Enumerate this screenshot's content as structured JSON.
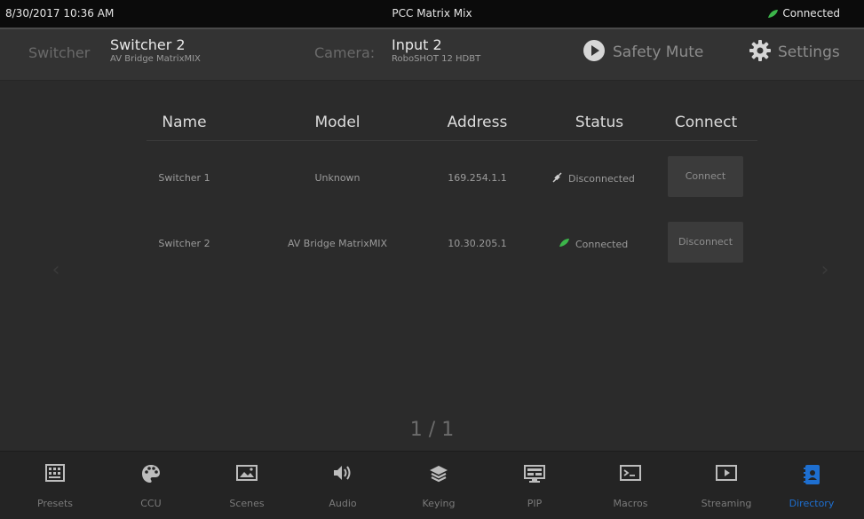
{
  "statusbar": {
    "datetime": "8/30/2017 10:36 AM",
    "title": "PCC Matrix Mix",
    "connection": "Connected"
  },
  "header": {
    "switcher_label": "Switcher",
    "switcher_name": "Switcher 2",
    "switcher_model": "AV Bridge MatrixMIX",
    "camera_label": "Camera:",
    "camera_name": "Input 2",
    "camera_model": "RoboSHOT 12 HDBT",
    "safety_mute": "Safety Mute",
    "settings": "Settings"
  },
  "table": {
    "headers": [
      "Name",
      "Model",
      "Address",
      "Status",
      "Connect"
    ],
    "rows": [
      {
        "name": "Switcher 1",
        "model": "Unknown",
        "address": "169.254.1.1",
        "status": "Disconnected",
        "action": "Connect"
      },
      {
        "name": "Switcher 2",
        "model": "AV Bridge MatrixMIX",
        "address": "10.30.205.1",
        "status": "Connected",
        "action": "Disconnect"
      }
    ]
  },
  "pagination": "1 / 1",
  "nav": {
    "items": [
      {
        "label": "Presets",
        "icon": "grid-icon"
      },
      {
        "label": "CCU",
        "icon": "palette-icon"
      },
      {
        "label": "Scenes",
        "icon": "image-icon"
      },
      {
        "label": "Audio",
        "icon": "speaker-icon"
      },
      {
        "label": "Keying",
        "icon": "layers-icon"
      },
      {
        "label": "PIP",
        "icon": "pip-icon"
      },
      {
        "label": "Macros",
        "icon": "terminal-icon"
      },
      {
        "label": "Streaming",
        "icon": "play-icon"
      },
      {
        "label": "Directory",
        "icon": "book-icon"
      }
    ],
    "active": "Directory"
  },
  "colors": {
    "background": "#2b2b2b",
    "header": "#333333",
    "statusbar": "#0b0b0b",
    "connected_green": "#3cb54a",
    "active_blue": "#1e6fd0",
    "button": "#3b3b3b"
  }
}
